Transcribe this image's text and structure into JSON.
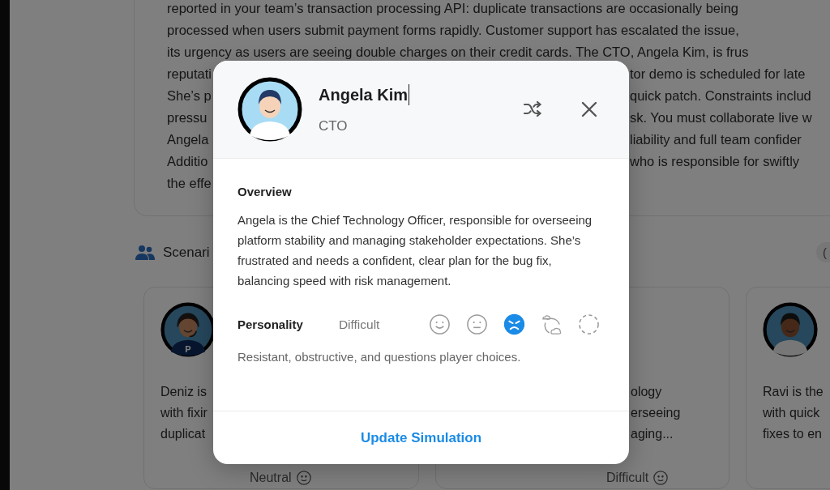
{
  "background": {
    "scenario_lines": [
      {
        "left": "reported in your team’s transaction processing API: duplicate transactions are occasionally being"
      },
      {
        "left": "processed when users submit payment forms rapidly. Customer support has escalated the issue,"
      },
      {
        "left": "its urgency as users are seeing double charges on their credit cards. The CTO, Angela Kim, is frus"
      },
      {
        "left": "reputati",
        "right": "tor demo is scheduled for late"
      },
      {
        "left": "She’s p",
        "right": "quick patch. Constraints includ"
      },
      {
        "left": "pressu",
        "right": "sk. You must collaborate live w"
      },
      {
        "left": "Angela",
        "right": "liability and full team confider"
      },
      {
        "left": "Additio",
        "right": "who is responsible for swiftly"
      },
      {
        "left": "the effe"
      }
    ],
    "section_title": "Scenari",
    "count_badge": "(",
    "cards": [
      {
        "kind": "headset",
        "shirt_letter": "P",
        "description_lines": [
          "Deniz is",
          "with fixir",
          "duplicat"
        ],
        "personality": "Neutral"
      },
      {
        "description_lines": [
          "ology",
          "erseeing",
          "aging..."
        ],
        "personality": "Difficult"
      },
      {
        "kind": "plain",
        "description_lines": [
          "Ravi is the",
          "with quick",
          "fixes to en"
        ]
      }
    ]
  },
  "modal": {
    "name": "Angela Kim",
    "role": "CTO",
    "overview_title": "Overview",
    "overview": "Angela is the Chief Technology Officer, responsible for overseeing platform stability and managing stakeholder expectations. She’s frustrated and needs a confident, clear plan for the bug fix, balancing speed with risk management.",
    "personality_label": "Personality",
    "personality_value": "Difficult",
    "moods": [
      {
        "kind": "happy",
        "selected": false
      },
      {
        "kind": "neutral",
        "selected": false
      },
      {
        "kind": "angry",
        "selected": true
      },
      {
        "kind": "mixed",
        "selected": false
      },
      {
        "kind": "none",
        "selected": false
      }
    ],
    "personality_description": "Resistant, obstructive, and questions player choices.",
    "action": "Update Simulation"
  }
}
